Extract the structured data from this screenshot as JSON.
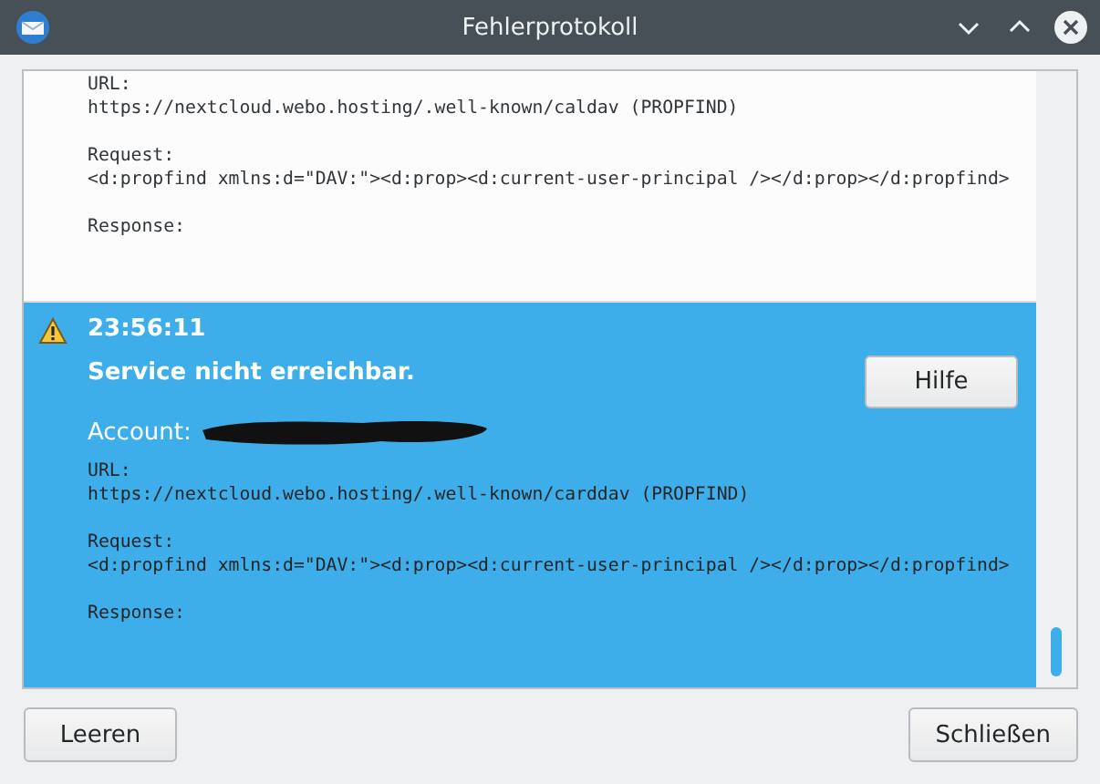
{
  "window": {
    "title": "Fehlerprotokoll"
  },
  "entries": [
    {
      "selected": false,
      "sections": [
        {
          "label": "URL:",
          "value": "https://nextcloud.webo.hosting/.well-known/caldav (PROPFIND)"
        },
        {
          "label": "Request:",
          "value": "<d:propfind xmlns:d=\"DAV:\"><d:prop><d:current-user-principal /></d:prop></d:propfind>"
        },
        {
          "label": "Response:"
        }
      ]
    },
    {
      "selected": true,
      "kind": "warning",
      "time": "23:56:11",
      "message": "Service nicht erreichbar.",
      "account_label": "Account:",
      "account_redacted": true,
      "action": "Hilfe",
      "sections": [
        {
          "label": "URL:",
          "value": "https://nextcloud.webo.hosting/.well-known/carddav (PROPFIND)"
        },
        {
          "label": "Request:",
          "value": "<d:propfind xmlns:d=\"DAV:\"><d:prop><d:current-user-principal /></d:prop></d:propfind>"
        },
        {
          "label": "Response:"
        }
      ]
    }
  ],
  "buttons": {
    "left": "Leeren",
    "right": "Schließen"
  }
}
